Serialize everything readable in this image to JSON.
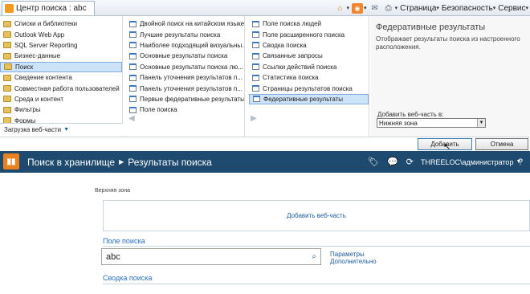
{
  "browser": {
    "tab_title": "Центр поиска : abc",
    "commands": {
      "page": "Страница",
      "security": "Безопасность",
      "service": "Сервис"
    }
  },
  "gallery": {
    "categories": [
      "Списки и библиотеки",
      "Outlook Web App",
      "SQL Server Reporting",
      "Бизнес-данные",
      "Поиск",
      "Сведение контента",
      "Совместная работа пользователей",
      "Среда и контент",
      "Фильтры",
      "Формы"
    ],
    "selected_category_index": 4,
    "upload_label": "Загрузка веб-части",
    "parts_col1": [
      "Двойной поиск на китайском языке",
      "Лучшие результаты поиска",
      "Наиболее подходящий визуальны...",
      "Основные результаты поиска",
      "Основные результаты поиска лю...",
      "Панель уточнения результатов п...",
      "Панель уточнения результатов п...",
      "Первые федеративные результаты",
      "Поле поиска"
    ],
    "parts_col2": [
      "Поле поиска людей",
      "Поле расширенного поиска",
      "Сводка поиска",
      "Связанные запросы",
      "Ссылки действий поиска",
      "Статистика поиска",
      "Страницы результатов поиска",
      "Федеративные результаты"
    ],
    "selected_part_index": 7,
    "description": {
      "title": "Федеративные результаты",
      "text": "Отображает результаты поиска из настроенного расположения."
    },
    "add_to_label": "Добавить веб-часть в:",
    "zone_value": "Нижняя зона",
    "add_button": "Добавить",
    "cancel_button": "Отмена"
  },
  "suite": {
    "breadcrumb": [
      "Поиск в хранилище",
      "Результаты поиска"
    ],
    "user": "THREELOC\\администратор",
    "help": "?"
  },
  "page": {
    "zone_label": "Верхняя зона",
    "add_webpart": "Добавить веб-часть",
    "search_box_title": "Поле поиска",
    "search_value": "abc",
    "link_params": "Параметры",
    "link_advanced": "Дополнительно",
    "summary_title": "Сводка поиска"
  },
  "colors": {
    "suite_bar": "#1d4a6e",
    "link": "#1a5c9e",
    "selection": "#cde3f7",
    "logo": "#e8821f"
  }
}
